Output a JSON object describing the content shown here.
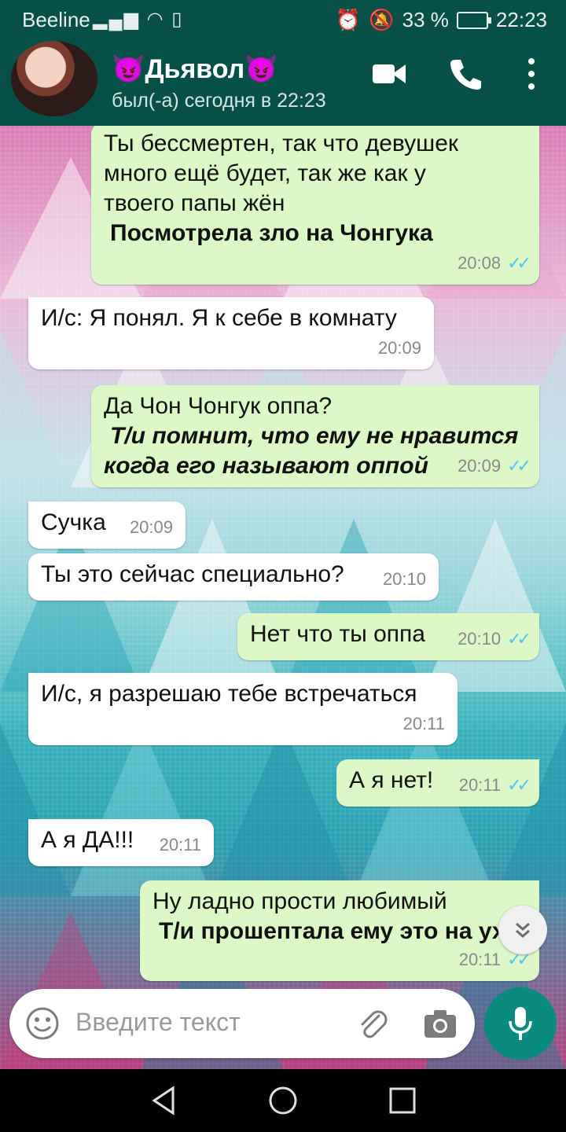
{
  "status_bar": {
    "carrier": "Beeline",
    "battery": "33 %",
    "time": "22:23"
  },
  "header": {
    "contact_name": "😈Дьявол😈",
    "contact_status": "был(-а) сегодня в 22:23"
  },
  "messages": [
    {
      "dir": "out",
      "lines": [
        "Ты бессмертен, так что девушек",
        "много ещё будет, так же как у",
        "твоего папы жён"
      ],
      "action": "Посмотрела зло на Чонгука",
      "time": "20:08"
    },
    {
      "dir": "in",
      "lines": [
        "И/с: Я понял. Я к себе в комнату"
      ],
      "time": "20:09"
    },
    {
      "dir": "out",
      "lines": [
        "Да Чон Чонгук оппа?"
      ],
      "action": [
        "Т/и помнит, что ему не нравится",
        "когда его называют оппой"
      ],
      "time": "20:09"
    },
    {
      "dir": "in",
      "lines": [
        "Сучка"
      ],
      "time": "20:09"
    },
    {
      "dir": "in",
      "lines": [
        "Ты это сейчас специально?"
      ],
      "time": "20:10"
    },
    {
      "dir": "out",
      "lines": [
        "Нет что ты оппа"
      ],
      "time": "20:10"
    },
    {
      "dir": "in",
      "lines": [
        "И/с, я разрешаю тебе встречаться"
      ],
      "time": "20:11"
    },
    {
      "dir": "out",
      "lines": [
        "А я нет!"
      ],
      "time": "20:11"
    },
    {
      "dir": "in",
      "lines": [
        "А я ДА!!!"
      ],
      "time": "20:11"
    },
    {
      "dir": "out",
      "lines": [
        "Ну ладно прости любимый"
      ],
      "action": "Т/и прошептала ему это на ухо",
      "time": "20:11"
    }
  ],
  "input": {
    "placeholder": "Введите текст"
  },
  "colors": {
    "header": "#075048",
    "outgoing_bubble": "#dcf8c6",
    "incoming_bubble": "#ffffff",
    "read_ticks": "#4fc3f7",
    "mic_button": "#0b8a7f"
  }
}
